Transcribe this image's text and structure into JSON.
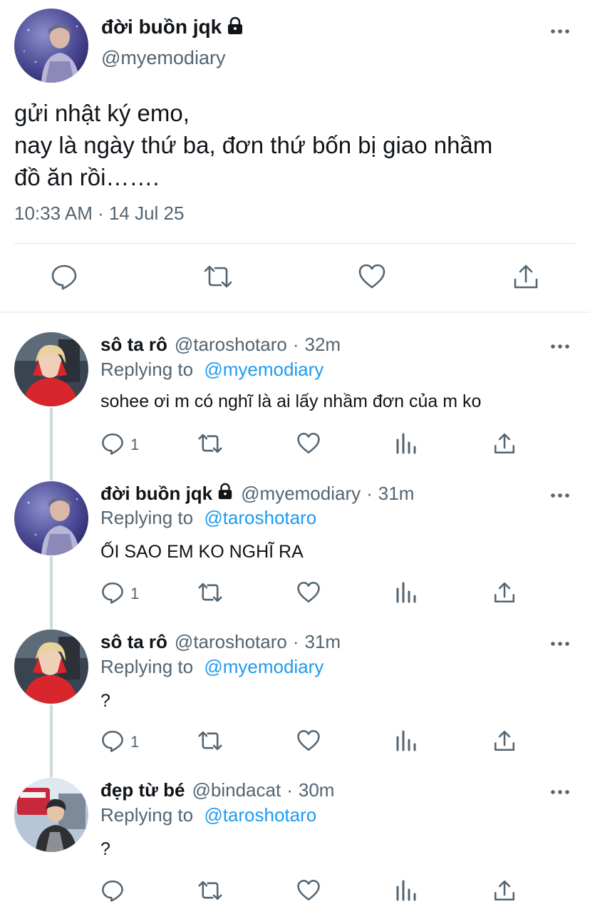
{
  "main_tweet": {
    "author_name": "đời buồn jqk",
    "handle": "@myemodiary",
    "text_lines": [
      "gửi nhật ký emo,",
      "nay là ngày thứ ba, đơn thứ bốn bị giao nhầm",
      "đồ ăn rồi……."
    ],
    "time": "10:33 AM · 14 Jul 25",
    "icons": [
      "reply-icon",
      "retweet-icon",
      "like-icon",
      "share-icon"
    ]
  },
  "replies": [
    {
      "author_name": "sô ta rô",
      "handle": "@taroshotaro",
      "dot": "·",
      "time": "32m",
      "replying_prefix": "Replying to",
      "replying_to": "@myemodiary",
      "text": "sohee ơi m có nghĩ là ai lấy nhầm đơn của m ko",
      "reply_count": "1"
    },
    {
      "author_name": "đời buồn jqk",
      "handle": "@myemodiary",
      "dot": "·",
      "time": "31m",
      "replying_prefix": "Replying to",
      "replying_to": "@taroshotaro",
      "text": "ỐI SAO EM KO NGHĨ RA",
      "reply_count": "1"
    },
    {
      "author_name": "sô ta rô",
      "handle": "@taroshotaro",
      "dot": "·",
      "time": "31m",
      "replying_prefix": "Replying to",
      "replying_to": "@myemodiary",
      "text": "?",
      "reply_count": "1"
    },
    {
      "author_name": "đẹp từ bé",
      "handle": "@bindacat",
      "dot": "·",
      "time": "30m",
      "replying_prefix": "Replying to",
      "replying_to": "@taroshotaro",
      "text": "?",
      "reply_count": ""
    }
  ],
  "colors": {
    "text": "#0f1419",
    "secondary": "#536471",
    "link": "#1d9bf0",
    "divider": "#eff3f4",
    "thread_line": "#cfd9de"
  }
}
